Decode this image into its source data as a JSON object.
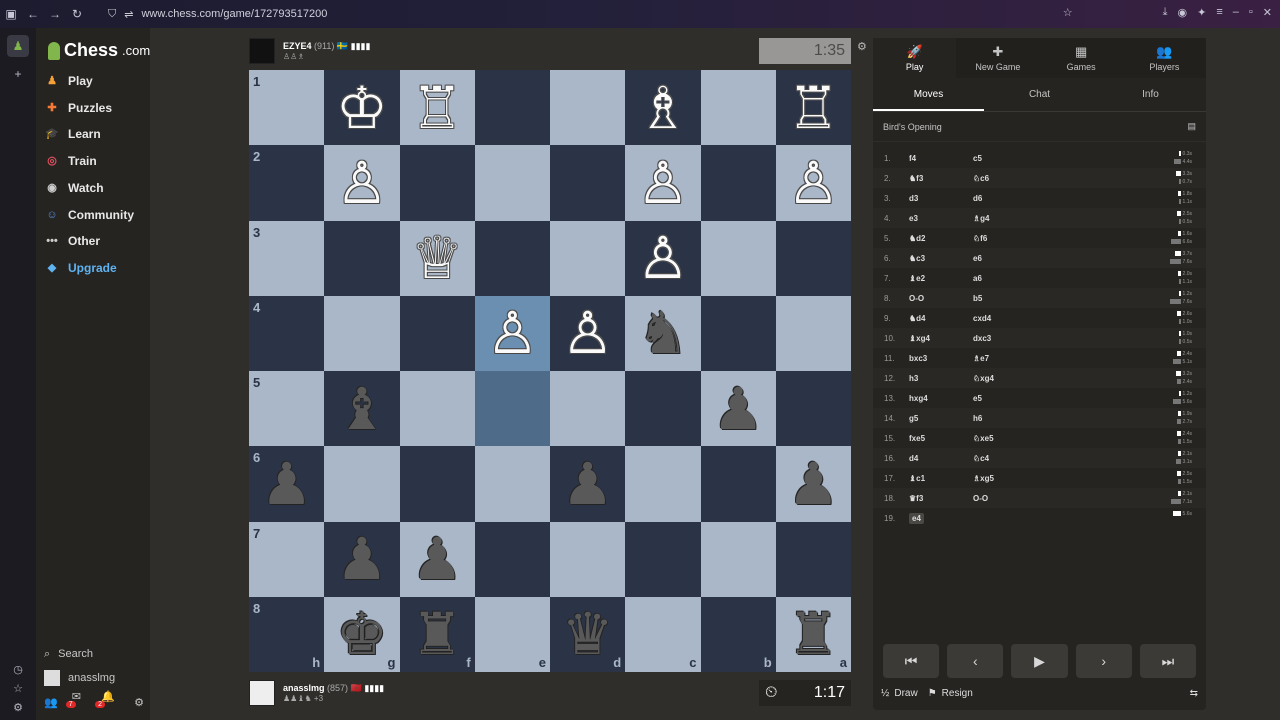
{
  "browser": {
    "url": "www.chess.com/game/172793517200"
  },
  "sidebar": {
    "logo": "Chess",
    "logo_suffix": ".com",
    "items": [
      {
        "label": "Play",
        "icon": "play-icon",
        "color": "#f6a03a"
      },
      {
        "label": "Puzzles",
        "icon": "puzzle-icon",
        "color": "#f47a36"
      },
      {
        "label": "Learn",
        "icon": "learn-icon",
        "color": "#3aa0e0"
      },
      {
        "label": "Train",
        "icon": "train-icon",
        "color": "#e05060"
      },
      {
        "label": "Watch",
        "icon": "watch-icon",
        "color": "#cfcfcf"
      },
      {
        "label": "Community",
        "icon": "community-icon",
        "color": "#5a90e0"
      },
      {
        "label": "Other",
        "icon": "more-icon",
        "color": "#cfcfcf"
      },
      {
        "label": "Upgrade",
        "icon": "diamond-icon",
        "color": "#5fb3f0"
      }
    ],
    "search_label": "Search",
    "username": "anasslmg",
    "mail_badge": "7",
    "notif_badge": "2"
  },
  "top_player": {
    "name": "EZYE4",
    "rating": "(911)",
    "flag": "🇸🇪",
    "clock": "1:35"
  },
  "bottom_player": {
    "name": "anasslmg",
    "rating": "(857)",
    "flag": "🇲🇦",
    "captured_extra": "+3",
    "clock": "1:17"
  },
  "panel": {
    "tabs": [
      {
        "label": "Play"
      },
      {
        "label": "New Game"
      },
      {
        "label": "Games"
      },
      {
        "label": "Players"
      }
    ],
    "subtabs": [
      {
        "label": "Moves"
      },
      {
        "label": "Chat"
      },
      {
        "label": "Info"
      }
    ],
    "opening": "Bird's Opening",
    "moves": [
      {
        "n": "1.",
        "w": "f4",
        "b": "c5",
        "tw": "0.3s",
        "tb": "4.4s"
      },
      {
        "n": "2.",
        "w": "♞f3",
        "b": "♘c6",
        "tw": "3.3s",
        "tb": "0.7s"
      },
      {
        "n": "3.",
        "w": "d3",
        "b": "d6",
        "tw": "1.8s",
        "tb": "1.1s"
      },
      {
        "n": "4.",
        "w": "e3",
        "b": "♗g4",
        "tw": "2.5s",
        "tb": "0.5s"
      },
      {
        "n": "5.",
        "w": "♞d2",
        "b": "♘f6",
        "tw": "1.6s",
        "tb": "6.6s"
      },
      {
        "n": "6.",
        "w": "♞c3",
        "b": "e6",
        "tw": "3.7s",
        "tb": "7.6s"
      },
      {
        "n": "7.",
        "w": "♝e2",
        "b": "a6",
        "tw": "2.0s",
        "tb": "1.1s"
      },
      {
        "n": "8.",
        "w": "O-O",
        "b": "b5",
        "tw": "1.2s",
        "tb": "7.6s"
      },
      {
        "n": "9.",
        "w": "♞d4",
        "b": "cxd4",
        "tw": "2.6s",
        "tb": "1.0s"
      },
      {
        "n": "10.",
        "w": "♝xg4",
        "b": "dxc3",
        "tw": "1.0s",
        "tb": "0.5s"
      },
      {
        "n": "11.",
        "w": "bxc3",
        "b": "♗e7",
        "tw": "2.4s",
        "tb": "5.1s"
      },
      {
        "n": "12.",
        "w": "h3",
        "b": "♘xg4",
        "tw": "3.2s",
        "tb": "2.4s"
      },
      {
        "n": "13.",
        "w": "hxg4",
        "b": "e5",
        "tw": "1.2s",
        "tb": "5.6s"
      },
      {
        "n": "14.",
        "w": "g5",
        "b": "h6",
        "tw": "1.9s",
        "tb": "2.7s"
      },
      {
        "n": "15.",
        "w": "fxe5",
        "b": "♘xe5",
        "tw": "2.4s",
        "tb": "1.5s"
      },
      {
        "n": "16.",
        "w": "d4",
        "b": "♘c4",
        "tw": "2.1s",
        "tb": "3.1s"
      },
      {
        "n": "17.",
        "w": "♝c1",
        "b": "♗xg5",
        "tw": "2.5s",
        "tb": "1.5s"
      },
      {
        "n": "18.",
        "w": "♛f3",
        "b": "O-O",
        "tw": "2.1s",
        "tb": "7.1s"
      },
      {
        "n": "19.",
        "w": "e4",
        "b": "",
        "tw": "5.6s",
        "tb": ""
      }
    ],
    "footer": {
      "draw": "Draw",
      "draw_prefix": "½",
      "resign": "Resign"
    }
  },
  "board": {
    "ranks": [
      "1",
      "2",
      "3",
      "4",
      "5",
      "6",
      "7",
      "8"
    ],
    "files": [
      "h",
      "g",
      "f",
      "e",
      "d",
      "c",
      "b",
      "a"
    ],
    "rows": [
      [
        "",
        "wK",
        "wR",
        "",
        "",
        "wB",
        "",
        "wR"
      ],
      [
        "",
        "wP",
        "",
        "",
        "",
        "wP",
        "",
        "wP"
      ],
      [
        "",
        "",
        "wQ",
        "",
        "",
        "wP",
        "",
        ""
      ],
      [
        "",
        "",
        "",
        "wP",
        "wP",
        "bN",
        "",
        ""
      ],
      [
        "",
        "bB",
        "",
        "",
        "",
        "",
        "bP",
        ""
      ],
      [
        "bP",
        "",
        "",
        "",
        "bP",
        "",
        "",
        "bP"
      ],
      [
        "",
        "bP",
        "bP",
        "",
        "",
        "",
        "",
        ""
      ],
      [
        "",
        "bK",
        "bR",
        "",
        "bQ",
        "",
        "",
        "bR"
      ]
    ],
    "highlights": [
      "3-3",
      "4-3"
    ]
  }
}
